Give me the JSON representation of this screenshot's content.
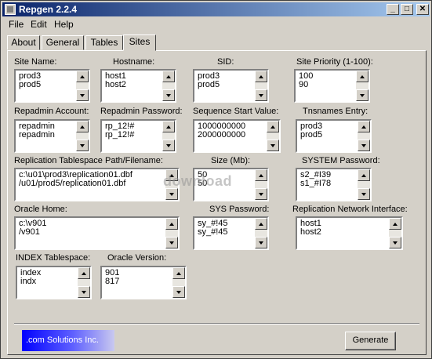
{
  "window": {
    "title": "Repgen 2.2.4"
  },
  "titlebar_buttons": {
    "minimize": "_",
    "maximize": "□",
    "close": "✕"
  },
  "menu": [
    "File",
    "Edit",
    "Help"
  ],
  "tabs": [
    "About",
    "General",
    "Tables",
    "Sites"
  ],
  "fields": {
    "site_name": {
      "label": "Site Name:",
      "values": [
        "prod3",
        "prod5"
      ]
    },
    "hostname": {
      "label": "Hostname:",
      "values": [
        "host1",
        "host2"
      ]
    },
    "sid": {
      "label": "SID:",
      "values": [
        "prod3",
        "prod5"
      ]
    },
    "site_priority": {
      "label": "Site Priority (1-100):",
      "values": [
        "100",
        "90"
      ]
    },
    "repadmin_account": {
      "label": "Repadmin Account:",
      "values": [
        "repadmin",
        "repadmin"
      ]
    },
    "repadmin_password": {
      "label": "Repadmin Password:",
      "values": [
        "rp_12!#",
        "rp_12!#"
      ]
    },
    "sequence_start": {
      "label": "Sequence Start Value:",
      "values": [
        "1000000000",
        "2000000000"
      ]
    },
    "tnsnames": {
      "label": "Tnsnames Entry:",
      "values": [
        "prod3",
        "prod5"
      ]
    },
    "tablespace_path": {
      "label": "Replication Tablespace Path/Filename:",
      "values": [
        "c:\\u01\\prod3\\replication01.dbf",
        "/u01/prod5/replication01.dbf"
      ]
    },
    "size": {
      "label": "Size (Mb):",
      "values": [
        "50",
        "50"
      ]
    },
    "system_password": {
      "label": "SYSTEM Password:",
      "values": [
        "s2_#I39",
        "s1_#I78"
      ]
    },
    "oracle_home": {
      "label": "Oracle Home:",
      "values": [
        "c:\\v901",
        "/v901"
      ]
    },
    "sys_password": {
      "label": "SYS Password:",
      "values": [
        "sy_#!45",
        "sy_#!45"
      ]
    },
    "network_interface": {
      "label": "Replication Network Interface:",
      "values": [
        "host1",
        "host2"
      ]
    },
    "index_tablespace": {
      "label": "INDEX Tablespace:",
      "values": [
        "index",
        "indx"
      ]
    },
    "oracle_version": {
      "label": "Oracle Version:",
      "values": [
        "901",
        "817"
      ]
    }
  },
  "logo_text": ".com Solutions Inc.",
  "generate_label": "Generate",
  "watermark": "download"
}
